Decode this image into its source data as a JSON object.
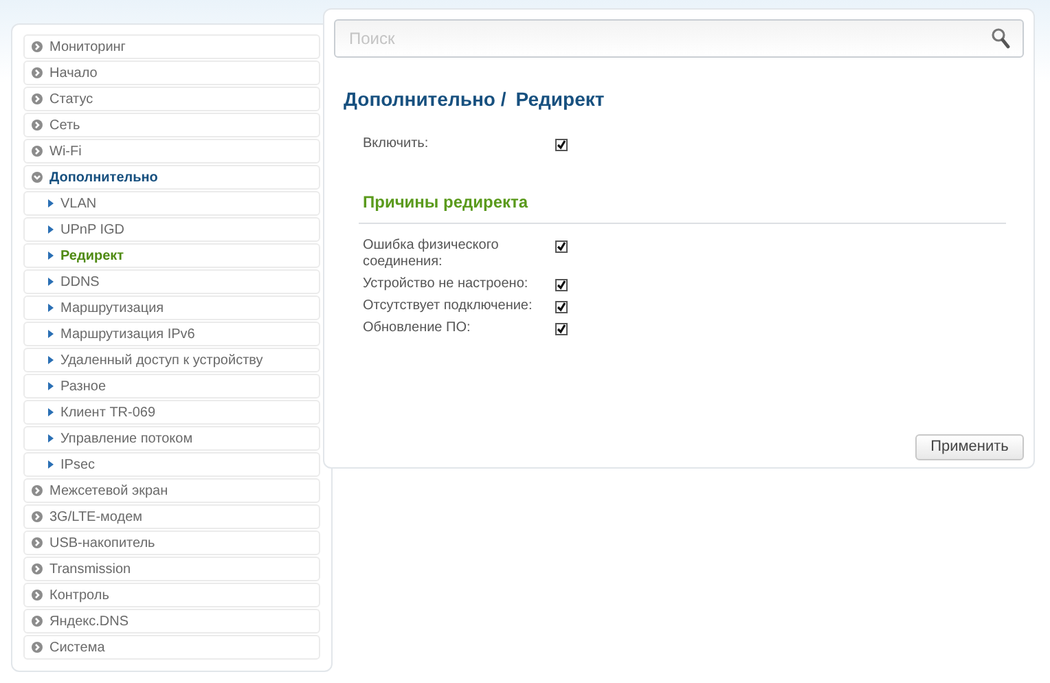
{
  "sidebar": {
    "items": [
      {
        "label": "Мониторинг",
        "expanded": false,
        "selected": false
      },
      {
        "label": "Начало",
        "expanded": false,
        "selected": false
      },
      {
        "label": "Статус",
        "expanded": false,
        "selected": false
      },
      {
        "label": "Сеть",
        "expanded": false,
        "selected": false
      },
      {
        "label": "Wi-Fi",
        "expanded": false,
        "selected": false
      },
      {
        "label": "Дополнительно",
        "expanded": true,
        "selected": true,
        "children": [
          {
            "label": "VLAN",
            "selected": false
          },
          {
            "label": "UPnP IGD",
            "selected": false
          },
          {
            "label": "Редирект",
            "selected": true
          },
          {
            "label": "DDNS",
            "selected": false
          },
          {
            "label": "Маршрутизация",
            "selected": false
          },
          {
            "label": "Маршрутизация IPv6",
            "selected": false
          },
          {
            "label": "Удаленный доступ к устройству",
            "selected": false
          },
          {
            "label": "Разное",
            "selected": false
          },
          {
            "label": "Клиент TR-069",
            "selected": false
          },
          {
            "label": "Управление потоком",
            "selected": false
          },
          {
            "label": "IPsec",
            "selected": false
          }
        ]
      },
      {
        "label": "Межсетевой экран",
        "expanded": false,
        "selected": false
      },
      {
        "label": "3G/LTE-модем",
        "expanded": false,
        "selected": false
      },
      {
        "label": "USB-накопитель",
        "expanded": false,
        "selected": false
      },
      {
        "label": "Transmission",
        "expanded": false,
        "selected": false
      },
      {
        "label": "Контроль",
        "expanded": false,
        "selected": false
      },
      {
        "label": "Яндекс.DNS",
        "expanded": false,
        "selected": false
      },
      {
        "label": "Система",
        "expanded": false,
        "selected": false
      }
    ]
  },
  "search": {
    "placeholder": "Поиск"
  },
  "breadcrumb": {
    "section": "Дополнительно /",
    "page": "Редирект"
  },
  "enable": {
    "label": "Включить:",
    "checked": true
  },
  "reasons": {
    "title": "Причины редиректа",
    "items": [
      {
        "label": "Ошибка физического соединения:",
        "checked": true
      },
      {
        "label": "Устройство не настроено:",
        "checked": true
      },
      {
        "label": "Отсутствует подключение:",
        "checked": true
      },
      {
        "label": "Обновление ПО:",
        "checked": true
      }
    ]
  },
  "apply_button": "Применить"
}
